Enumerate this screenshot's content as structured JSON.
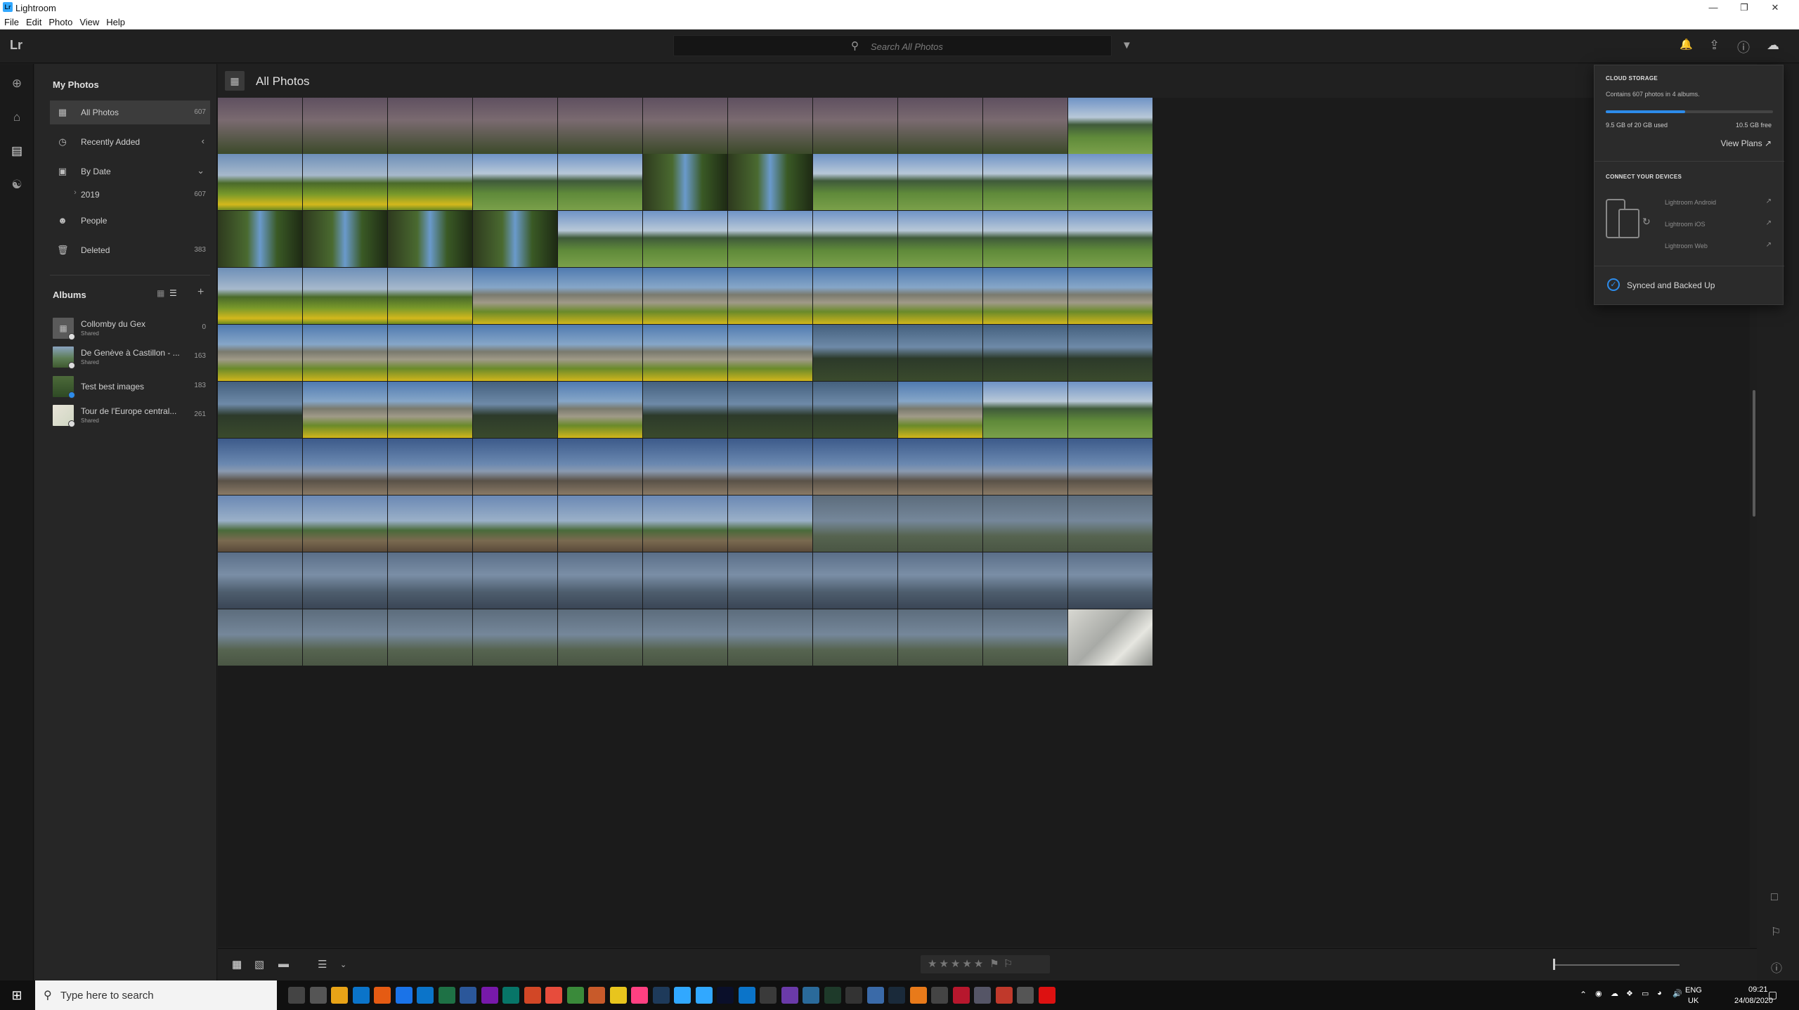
{
  "window": {
    "title": "Lightroom"
  },
  "menu": [
    "File",
    "Edit",
    "Photo",
    "View",
    "Help"
  ],
  "header": {
    "logo": "Lr",
    "search_placeholder": "Search All Photos"
  },
  "sidebar": {
    "my_photos_title": "My Photos",
    "items": [
      {
        "label": "All Photos",
        "count": "607",
        "icon": "photos-icon"
      },
      {
        "label": "Recently Added",
        "count": "",
        "icon": "clock-icon"
      },
      {
        "label": "By Date",
        "count": "",
        "icon": "calendar-icon"
      },
      {
        "label": "2019",
        "count": "607",
        "icon": ""
      },
      {
        "label": "People",
        "count": "",
        "icon": "person-icon"
      },
      {
        "label": "Deleted",
        "count": "383",
        "icon": "trash-icon"
      }
    ],
    "albums_title": "Albums",
    "albums": [
      {
        "name": "Collomby du Gex",
        "sub": "Shared",
        "count": "0"
      },
      {
        "name": "De Genève à Castillon - ...",
        "sub": "Shared",
        "count": "163"
      },
      {
        "name": "Test best images",
        "sub": "",
        "count": "183"
      },
      {
        "name": "Tour de l'Europe central...",
        "sub": "Shared",
        "count": "261"
      }
    ]
  },
  "main": {
    "title": "All Photos"
  },
  "cloud": {
    "title": "CLOUD STORAGE",
    "summary": "Contains 607 photos in 4 albums.",
    "used_fraction": 0.475,
    "used": "9.5 GB of 20 GB used",
    "free": "10.5 GB free",
    "view_plans": "View Plans",
    "devices_title": "CONNECT YOUR DEVICES",
    "devices": [
      "Lightroom Android",
      "Lightroom iOS",
      "Lightroom Web"
    ],
    "status": "Synced and Backed Up"
  },
  "toolbar": {
    "rating": "★★★★★"
  },
  "taskbar": {
    "search_placeholder": "Type here to search",
    "lang1": "ENG",
    "lang2": "UK",
    "time": "09:21",
    "date": "24/08/2020"
  }
}
